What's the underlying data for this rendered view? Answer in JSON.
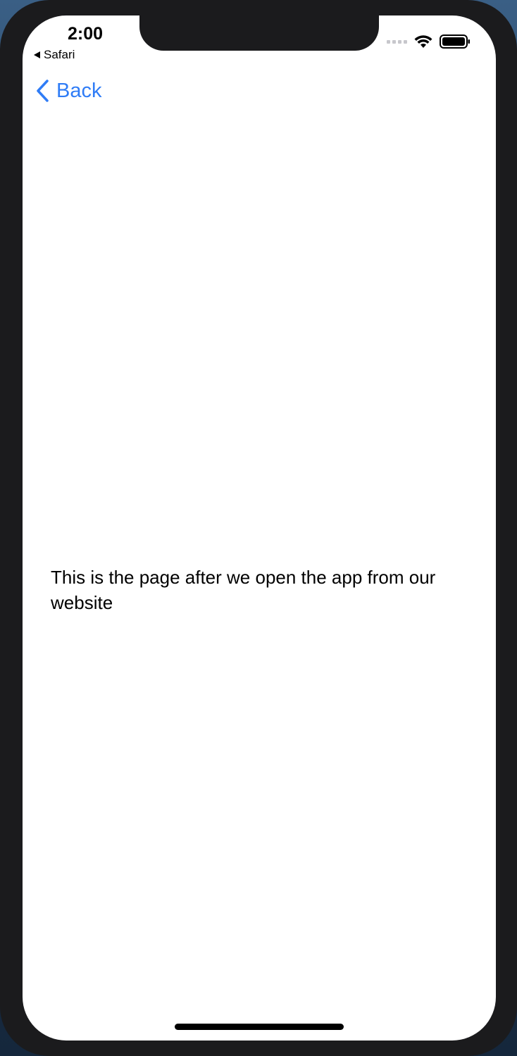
{
  "status_bar": {
    "time": "2:00",
    "back_to_app": "Safari",
    "icons": [
      "signal-dots-icon",
      "wifi-icon",
      "battery-icon"
    ]
  },
  "nav": {
    "back_label": "Back",
    "back_icon": "chevron-left-icon"
  },
  "content": {
    "message": "This is the page after we open the app from our website"
  },
  "colors": {
    "accent": "#2f7cf6",
    "background": "#ffffff",
    "device_frame": "#1b1b1d"
  }
}
